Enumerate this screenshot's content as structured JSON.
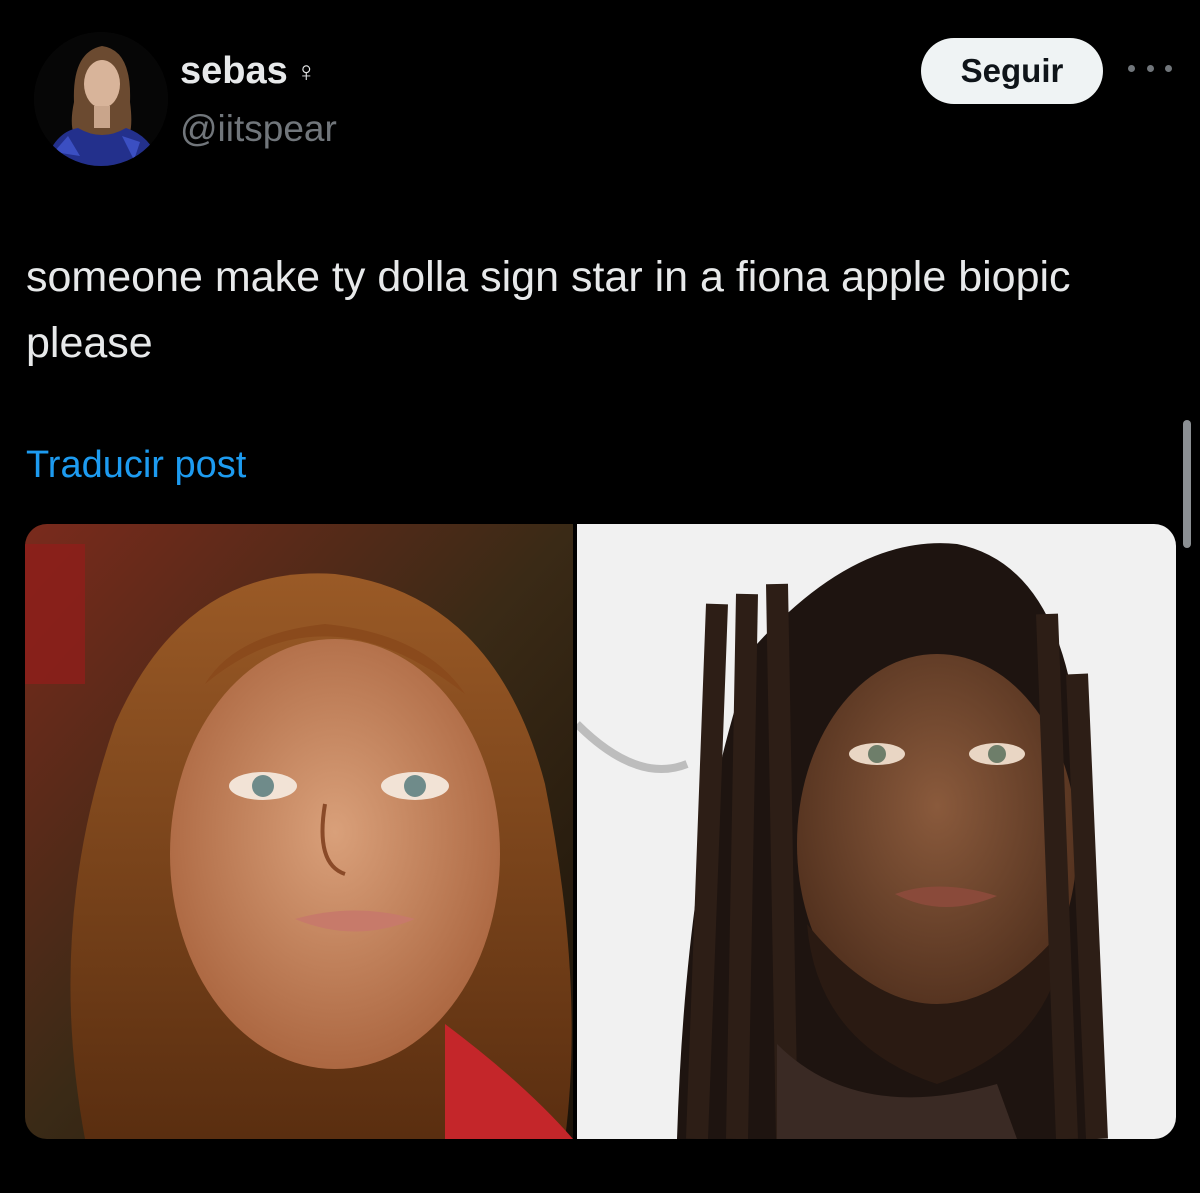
{
  "user": {
    "display_name": "sebas",
    "gender_symbol": "♀",
    "handle": "@iitspear"
  },
  "actions": {
    "follow_label": "Seguir",
    "more_icon": "more-horizontal-icon"
  },
  "post": {
    "text": "someone make ty dolla sign star in a fiona apple biopic please",
    "translate_label": "Traducir post"
  },
  "colors": {
    "background": "#000000",
    "primary_text": "#e7e9ea",
    "secondary_text": "#71767b",
    "link": "#1d9bf0",
    "follow_bg": "#eff3f4"
  }
}
